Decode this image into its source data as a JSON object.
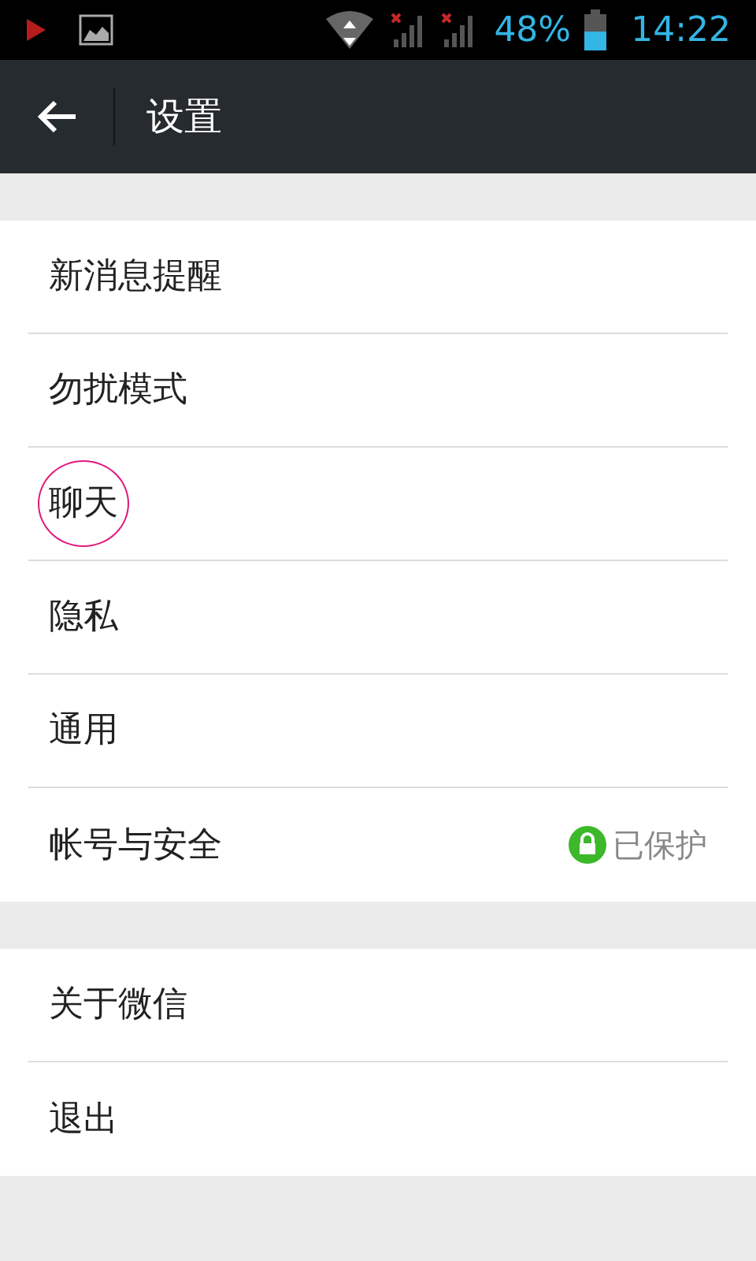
{
  "status_bar": {
    "battery": "48%",
    "time": "14:22"
  },
  "header": {
    "title": "设置"
  },
  "groups": [
    {
      "items": [
        {
          "label": "新消息提醒",
          "circled": false
        },
        {
          "label": "勿扰模式",
          "circled": false
        },
        {
          "label": "聊天",
          "circled": true
        },
        {
          "label": "隐私",
          "circled": false
        },
        {
          "label": "通用",
          "circled": false
        },
        {
          "label": "帐号与安全",
          "circled": false,
          "status": "已保护"
        }
      ]
    },
    {
      "items": [
        {
          "label": "关于微信",
          "circled": false
        },
        {
          "label": "退出",
          "circled": false
        }
      ]
    }
  ]
}
